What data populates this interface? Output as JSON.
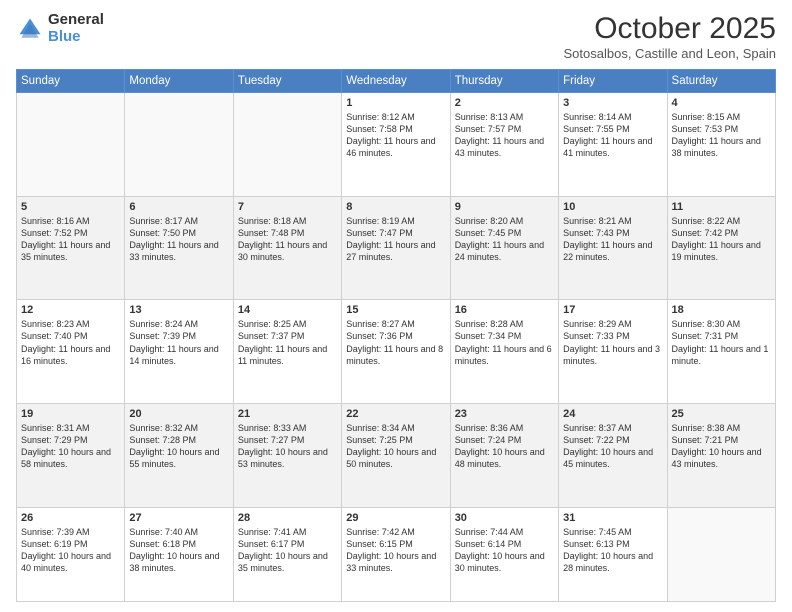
{
  "logo": {
    "general": "General",
    "blue": "Blue"
  },
  "header": {
    "month": "October 2025",
    "location": "Sotosalbos, Castille and Leon, Spain"
  },
  "weekdays": [
    "Sunday",
    "Monday",
    "Tuesday",
    "Wednesday",
    "Thursday",
    "Friday",
    "Saturday"
  ],
  "weeks": [
    [
      {
        "day": "",
        "info": ""
      },
      {
        "day": "",
        "info": ""
      },
      {
        "day": "",
        "info": ""
      },
      {
        "day": "1",
        "info": "Sunrise: 8:12 AM\nSunset: 7:58 PM\nDaylight: 11 hours and 46 minutes."
      },
      {
        "day": "2",
        "info": "Sunrise: 8:13 AM\nSunset: 7:57 PM\nDaylight: 11 hours and 43 minutes."
      },
      {
        "day": "3",
        "info": "Sunrise: 8:14 AM\nSunset: 7:55 PM\nDaylight: 11 hours and 41 minutes."
      },
      {
        "day": "4",
        "info": "Sunrise: 8:15 AM\nSunset: 7:53 PM\nDaylight: 11 hours and 38 minutes."
      }
    ],
    [
      {
        "day": "5",
        "info": "Sunrise: 8:16 AM\nSunset: 7:52 PM\nDaylight: 11 hours and 35 minutes."
      },
      {
        "day": "6",
        "info": "Sunrise: 8:17 AM\nSunset: 7:50 PM\nDaylight: 11 hours and 33 minutes."
      },
      {
        "day": "7",
        "info": "Sunrise: 8:18 AM\nSunset: 7:48 PM\nDaylight: 11 hours and 30 minutes."
      },
      {
        "day": "8",
        "info": "Sunrise: 8:19 AM\nSunset: 7:47 PM\nDaylight: 11 hours and 27 minutes."
      },
      {
        "day": "9",
        "info": "Sunrise: 8:20 AM\nSunset: 7:45 PM\nDaylight: 11 hours and 24 minutes."
      },
      {
        "day": "10",
        "info": "Sunrise: 8:21 AM\nSunset: 7:43 PM\nDaylight: 11 hours and 22 minutes."
      },
      {
        "day": "11",
        "info": "Sunrise: 8:22 AM\nSunset: 7:42 PM\nDaylight: 11 hours and 19 minutes."
      }
    ],
    [
      {
        "day": "12",
        "info": "Sunrise: 8:23 AM\nSunset: 7:40 PM\nDaylight: 11 hours and 16 minutes."
      },
      {
        "day": "13",
        "info": "Sunrise: 8:24 AM\nSunset: 7:39 PM\nDaylight: 11 hours and 14 minutes."
      },
      {
        "day": "14",
        "info": "Sunrise: 8:25 AM\nSunset: 7:37 PM\nDaylight: 11 hours and 11 minutes."
      },
      {
        "day": "15",
        "info": "Sunrise: 8:27 AM\nSunset: 7:36 PM\nDaylight: 11 hours and 8 minutes."
      },
      {
        "day": "16",
        "info": "Sunrise: 8:28 AM\nSunset: 7:34 PM\nDaylight: 11 hours and 6 minutes."
      },
      {
        "day": "17",
        "info": "Sunrise: 8:29 AM\nSunset: 7:33 PM\nDaylight: 11 hours and 3 minutes."
      },
      {
        "day": "18",
        "info": "Sunrise: 8:30 AM\nSunset: 7:31 PM\nDaylight: 11 hours and 1 minute."
      }
    ],
    [
      {
        "day": "19",
        "info": "Sunrise: 8:31 AM\nSunset: 7:29 PM\nDaylight: 10 hours and 58 minutes."
      },
      {
        "day": "20",
        "info": "Sunrise: 8:32 AM\nSunset: 7:28 PM\nDaylight: 10 hours and 55 minutes."
      },
      {
        "day": "21",
        "info": "Sunrise: 8:33 AM\nSunset: 7:27 PM\nDaylight: 10 hours and 53 minutes."
      },
      {
        "day": "22",
        "info": "Sunrise: 8:34 AM\nSunset: 7:25 PM\nDaylight: 10 hours and 50 minutes."
      },
      {
        "day": "23",
        "info": "Sunrise: 8:36 AM\nSunset: 7:24 PM\nDaylight: 10 hours and 48 minutes."
      },
      {
        "day": "24",
        "info": "Sunrise: 8:37 AM\nSunset: 7:22 PM\nDaylight: 10 hours and 45 minutes."
      },
      {
        "day": "25",
        "info": "Sunrise: 8:38 AM\nSunset: 7:21 PM\nDaylight: 10 hours and 43 minutes."
      }
    ],
    [
      {
        "day": "26",
        "info": "Sunrise: 7:39 AM\nSunset: 6:19 PM\nDaylight: 10 hours and 40 minutes."
      },
      {
        "day": "27",
        "info": "Sunrise: 7:40 AM\nSunset: 6:18 PM\nDaylight: 10 hours and 38 minutes."
      },
      {
        "day": "28",
        "info": "Sunrise: 7:41 AM\nSunset: 6:17 PM\nDaylight: 10 hours and 35 minutes."
      },
      {
        "day": "29",
        "info": "Sunrise: 7:42 AM\nSunset: 6:15 PM\nDaylight: 10 hours and 33 minutes."
      },
      {
        "day": "30",
        "info": "Sunrise: 7:44 AM\nSunset: 6:14 PM\nDaylight: 10 hours and 30 minutes."
      },
      {
        "day": "31",
        "info": "Sunrise: 7:45 AM\nSunset: 6:13 PM\nDaylight: 10 hours and 28 minutes."
      },
      {
        "day": "",
        "info": ""
      }
    ]
  ]
}
